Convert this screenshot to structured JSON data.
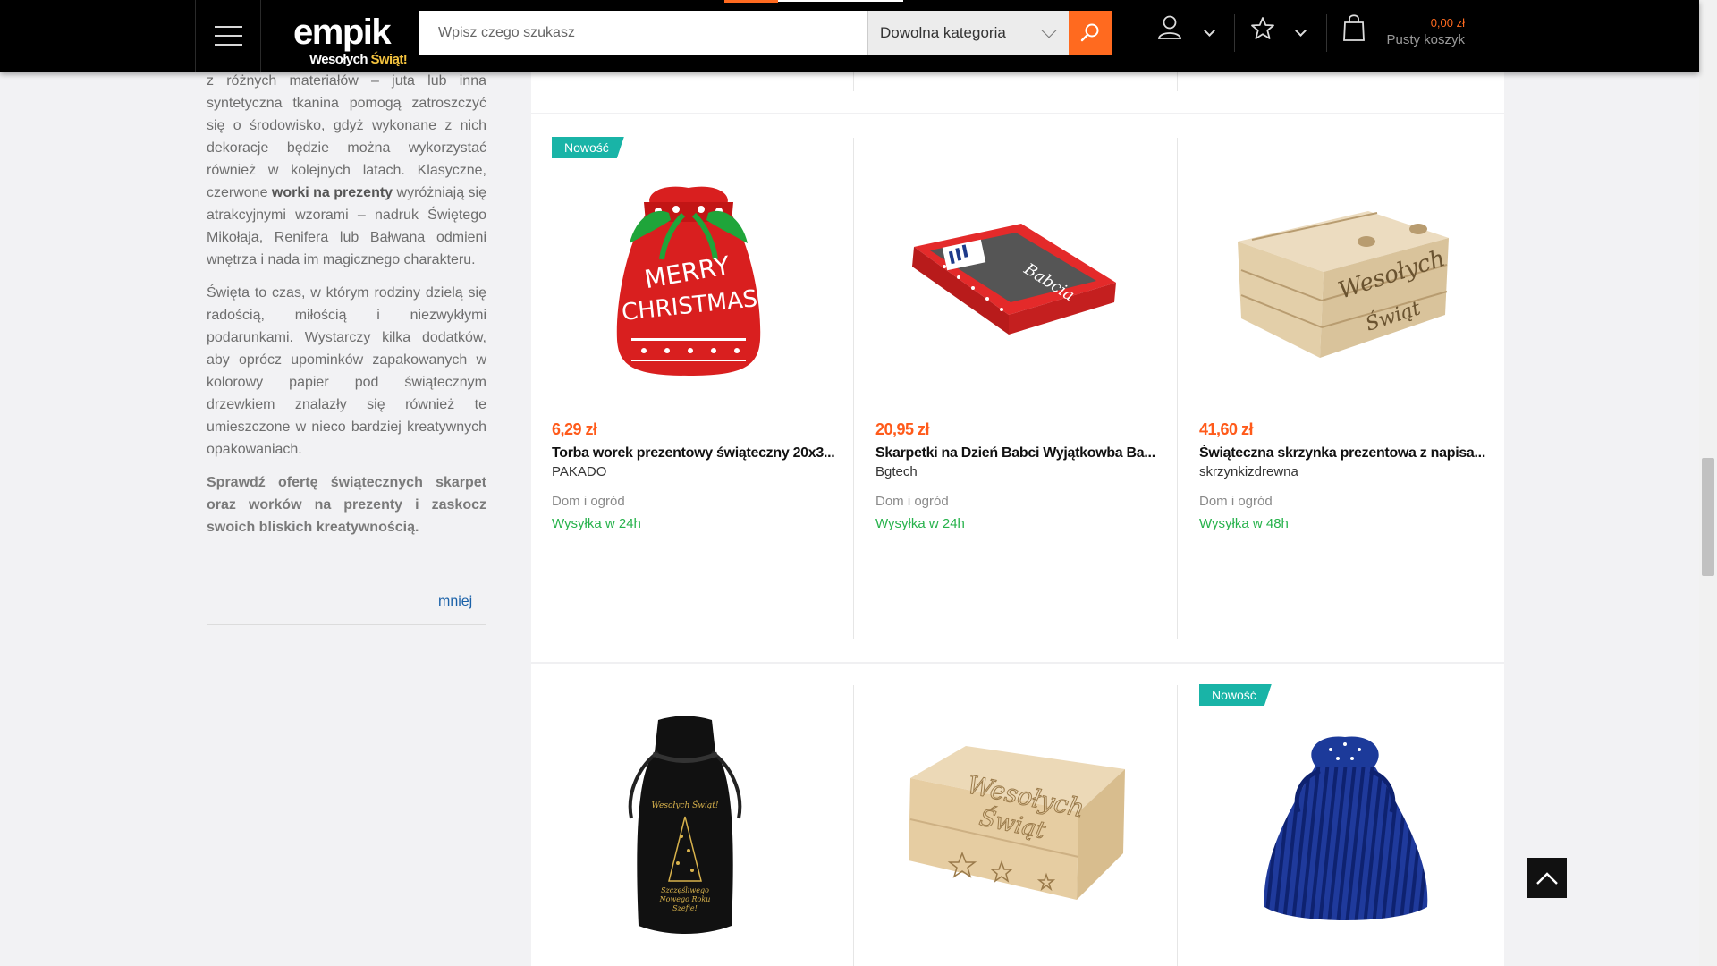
{
  "header": {
    "logo_main": "empik",
    "logo_sub_a": "Wesołych",
    "logo_sub_b": "Świąt!",
    "search_placeholder": "Wpisz czego szukasz",
    "category_label": "Dowolna kategoria",
    "cart_price": "0,00 zł",
    "cart_label": "Pusty koszyk"
  },
  "sidebar": {
    "p1_a": "z różnych materiałów – juta lub inna syntetyczna tkanina pomogą zatroszczyć się o środowisko, gdyż wykonane z nich dekoracje będzie można wykorzystać również w kolejnych latach. Klasyczne, czerwone ",
    "p1_bold": "worki na prezenty",
    "p1_b": " wyróżniają się atrakcyjnymi wzorami – nadruk Świętego Mikołaja, Renifera lub Bałwana odmieni wnętrza i nada im magicznego charakteru.",
    "p2": "Święta to czas, w którym rodziny dzielą się radością, miłością i niezwykłymi podarunkami. Wystarczy kilka dodatków, aby oprócz upominków zapakowanych w kolorowy papier pod świątecznym drzewkiem znalazły się również te umieszczone w nieco bardziej kreatywnych opakowaniach.",
    "p3": "Sprawdź ofertę świątecznych skarpet oraz worków na prezenty i zaskocz swoich bliskich kreatywnością.",
    "less_link": "mniej"
  },
  "products": [
    {
      "badge": "Nowość",
      "price": "6,29 zł",
      "title": "Torba worek prezentowy świąteczny 20x3...",
      "brand": "PAKADO",
      "category": "Dom i ogród",
      "shipping": "Wysyłka w 24h"
    },
    {
      "badge": "",
      "price": "20,95 zł",
      "title": "Skarpetki na Dzień Babci Wyjątkowba Ba...",
      "brand": "Bgtech",
      "category": "Dom i ogród",
      "shipping": "Wysyłka w 24h"
    },
    {
      "badge": "",
      "price": "41,60 zł",
      "title": "Świąteczna skrzynka prezentowa z napisa...",
      "brand": "skrzynkizdrewna",
      "category": "Dom i ogród",
      "shipping": "Wysyłka w 48h"
    },
    {
      "badge": "",
      "image_text_a": "Wesołych Świąt!",
      "image_text_b": "Szczęśliwego Nowego Roku Szefie!"
    },
    {
      "badge": "",
      "image_text_a": "Wesołych",
      "image_text_b": "Świąt"
    },
    {
      "badge": "Nowość"
    }
  ],
  "colors": {
    "accent": "#ff6a1f",
    "price": "#ff5a1a",
    "badge": "#19b4a7",
    "shipping": "#26b24b",
    "link": "#1a61a8"
  },
  "icons": [
    "menu-icon",
    "search-icon",
    "user-icon",
    "star-icon",
    "cart-icon",
    "arrow-up-icon"
  ]
}
